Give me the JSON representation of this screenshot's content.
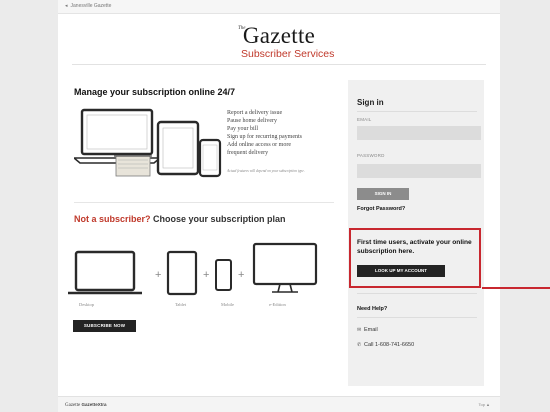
{
  "topbar": {
    "back_arrow": "◂",
    "back_label": "Janesville Gazette"
  },
  "logo": {
    "the": "The",
    "name": "Gazette",
    "subtitle": "Subscriber Services"
  },
  "manage": {
    "title": "Manage your subscription online 24/7",
    "benefits": [
      "Report a delivery issue",
      "Pause home delivery",
      "Pay your bill",
      "Sign up for recurring payments",
      "Add online access or more",
      "frequent delivery"
    ],
    "disclaimer": "Actual features will depend on your subscription type."
  },
  "plans": {
    "title_red": "Not a subscriber?",
    "title_dark": "Choose your subscription plan",
    "plus": "+",
    "labels": [
      "Desktop",
      "Tablet",
      "Mobile",
      "e-Edition"
    ],
    "subscribe_label": "SUBSCRIBE NOW"
  },
  "signin": {
    "title": "Sign in",
    "email_label": "EMAIL",
    "email_value": "",
    "password_label": "PASSWORD",
    "password_value": "",
    "button_label": "SIGN IN",
    "forgot_label": "Forgot Password?"
  },
  "activate": {
    "text": "First time users, activate your online subscription here.",
    "button_label": "LOOK UP MY ACCOUNT"
  },
  "help": {
    "title": "Need Help?",
    "email_icon": "envelope-icon",
    "email_label": "Email",
    "phone_icon": "phone-icon",
    "phone_label": "Call 1-608-741-6650"
  },
  "footer": {
    "logo_name": "Gazette",
    "logo_extra": "GazetteXtra",
    "top_label": "Top ▲"
  },
  "colors": {
    "accent_red": "#c0392b",
    "highlight_red": "#c8272f",
    "button_dark": "#232323",
    "panel_gray": "#f0f0f0"
  }
}
